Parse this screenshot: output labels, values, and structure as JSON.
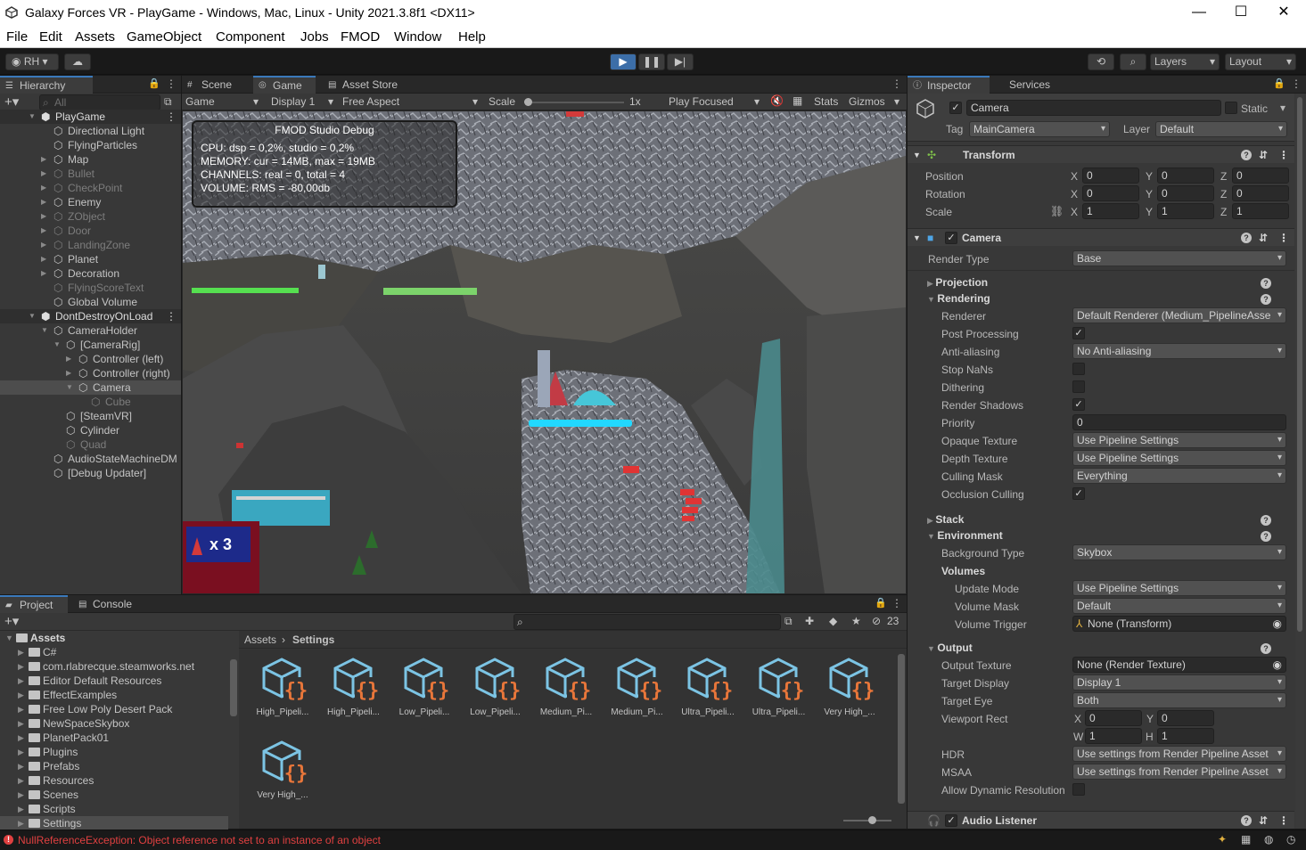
{
  "window": {
    "title": "Galaxy Forces VR - PlayGame - Windows, Mac, Linux - Unity 2021.3.8f1 <DX11>"
  },
  "menu": [
    "File",
    "Edit",
    "Assets",
    "GameObject",
    "Component",
    "Jobs",
    "FMOD",
    "Window",
    "Help"
  ],
  "toolbar": {
    "account": "RH",
    "layers": "Layers",
    "layout": "Layout"
  },
  "hierarchy": {
    "tab": "Hierarchy",
    "search_placeholder": "All",
    "rows": [
      {
        "label": "PlayGame",
        "depth": 0,
        "kind": "scene"
      },
      {
        "label": "Directional Light",
        "depth": 1
      },
      {
        "label": "FlyingParticles",
        "depth": 1
      },
      {
        "label": "Map",
        "depth": 1,
        "arrow": true
      },
      {
        "label": "Bullet",
        "depth": 1,
        "arrow": true,
        "dim": true
      },
      {
        "label": "CheckPoint",
        "depth": 1,
        "arrow": true,
        "dim": true
      },
      {
        "label": "Enemy",
        "depth": 1,
        "arrow": true
      },
      {
        "label": "ZObject",
        "depth": 1,
        "arrow": true,
        "dim": true
      },
      {
        "label": "Door",
        "depth": 1,
        "arrow": true,
        "dim": true
      },
      {
        "label": "LandingZone",
        "depth": 1,
        "arrow": true,
        "dim": true
      },
      {
        "label": "Planet",
        "depth": 1,
        "arrow": true
      },
      {
        "label": "Decoration",
        "depth": 1,
        "arrow": true
      },
      {
        "label": "FlyingScoreText",
        "depth": 1,
        "dim": true
      },
      {
        "label": "Global Volume",
        "depth": 1
      },
      {
        "label": "DontDestroyOnLoad",
        "depth": 0,
        "kind": "scene"
      },
      {
        "label": "CameraHolder",
        "depth": 1,
        "open": true
      },
      {
        "label": "[CameraRig]",
        "depth": 2,
        "open": true
      },
      {
        "label": "Controller (left)",
        "depth": 3,
        "arrow": true
      },
      {
        "label": "Controller (right)",
        "depth": 3,
        "arrow": true
      },
      {
        "label": "Camera",
        "depth": 3,
        "open": true,
        "sel": true
      },
      {
        "label": "Cube",
        "depth": 4,
        "dim": true
      },
      {
        "label": "[SteamVR]",
        "depth": 2
      },
      {
        "label": "Cylinder",
        "depth": 2
      },
      {
        "label": "Quad",
        "depth": 2,
        "dim": true
      },
      {
        "label": "AudioStateMachineDM",
        "depth": 1
      },
      {
        "label": "[Debug Updater]",
        "depth": 1
      }
    ]
  },
  "game": {
    "tabs": [
      "Scene",
      "Game",
      "Asset Store"
    ],
    "display_name": "Game",
    "display": "Display 1",
    "aspect": "Free Aspect",
    "scale_label": "Scale",
    "scale_value": "1x",
    "play_mode": "Play Focused",
    "stats": "Stats",
    "gizmos": "Gizmos",
    "fmod_title": "FMOD Studio Debug",
    "fmod_lines": [
      "CPU: dsp = 0,2%, studio = 0,2%",
      "MEMORY: cur = 14MB, max = 19MB",
      "CHANNELS: real = 0, total = 4",
      "VOLUME: RMS = -80,00db"
    ],
    "lives": "x 3"
  },
  "inspector": {
    "tabs": [
      "Inspector",
      "Services"
    ],
    "object_name": "Camera",
    "static_label": "Static",
    "tag_label": "Tag",
    "tag": "MainCamera",
    "layer_label": "Layer",
    "layer": "Default",
    "transform": {
      "title": "Transform",
      "position": {
        "label": "Position",
        "x": "0",
        "y": "0",
        "z": "0"
      },
      "rotation": {
        "label": "Rotation",
        "x": "0",
        "y": "0",
        "z": "0"
      },
      "scale": {
        "label": "Scale",
        "x": "1",
        "y": "1",
        "z": "1"
      }
    },
    "camera": {
      "title": "Camera",
      "render_type_label": "Render Type",
      "render_type": "Base",
      "projection": "Projection",
      "rendering": "Rendering",
      "renderer_label": "Renderer",
      "renderer": "Default Renderer (Medium_PipelineAsse",
      "post_label": "Post Processing",
      "aa_label": "Anti-aliasing",
      "aa": "No Anti-aliasing",
      "stopnans_label": "Stop NaNs",
      "dither_label": "Dithering",
      "shadows_label": "Render Shadows",
      "priority_label": "Priority",
      "priority": "0",
      "opaque_label": "Opaque Texture",
      "opaque": "Use Pipeline Settings",
      "depth_label": "Depth Texture",
      "depth": "Use Pipeline Settings",
      "cull_label": "Culling Mask",
      "cull": "Everything",
      "occl_label": "Occlusion Culling",
      "stack": "Stack",
      "environment": "Environment",
      "bg_label": "Background Type",
      "bg": "Skybox",
      "volumes": "Volumes",
      "update_label": "Update Mode",
      "update": "Use Pipeline Settings",
      "vmask_label": "Volume Mask",
      "vmask": "Default",
      "vtrig_label": "Volume Trigger",
      "vtrig": "None (Transform)",
      "output": "Output",
      "otex_label": "Output Texture",
      "otex": "None (Render Texture)",
      "tdisp_label": "Target Display",
      "tdisp": "Display 1",
      "teye_label": "Target Eye",
      "teye": "Both",
      "vrect_label": "Viewport Rect",
      "vr_x": "0",
      "vr_y": "0",
      "vr_w": "1",
      "vr_h": "1",
      "hdr_label": "HDR",
      "hdr": "Use settings from Render Pipeline Asset",
      "msaa_label": "MSAA",
      "msaa": "Use settings from Render Pipeline Asset",
      "dyn_label": "Allow Dynamic Resolution"
    },
    "audio_listener": "Audio Listener"
  },
  "project": {
    "tabs": [
      "Project",
      "Console"
    ],
    "hidden_count": "23",
    "breadcrumb": [
      "Assets",
      "Settings"
    ],
    "tree_root": "Assets",
    "folders": [
      "C#",
      "com.rlabrecque.steamworks.net",
      "Editor Default Resources",
      "EffectExamples",
      "Free Low Poly Desert Pack",
      "NewSpaceSkybox",
      "PlanetPack01",
      "Plugins",
      "Prefabs",
      "Resources",
      "Scenes",
      "Scripts",
      "Settings"
    ],
    "assets": [
      "High_Pipeli...",
      "High_Pipeli...",
      "Low_Pipeli...",
      "Low_Pipeli...",
      "Medium_Pi...",
      "Medium_Pi...",
      "Ultra_Pipeli...",
      "Ultra_Pipeli...",
      "Very High_...",
      "Very High_..."
    ]
  },
  "status": {
    "error": "NullReferenceException: Object reference not set to an instance of an object"
  },
  "colors": {
    "accent": "#3a79bb",
    "play_active": "#3c6ea8",
    "error": "#e04040"
  }
}
